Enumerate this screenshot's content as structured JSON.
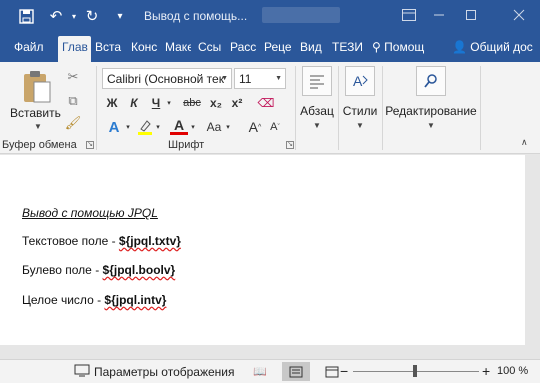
{
  "titlebar": {
    "save_icon": "save-icon",
    "undo_icon": "undo-icon",
    "redo_icon": "redo-icon",
    "customize_icon": "customize-quick-access-icon",
    "doc_title": "Вывод с помощь...",
    "restore_icon": "ribbon-display-options-icon",
    "minimize_icon": "minimize-icon",
    "maximize_icon": "maximize-icon",
    "close_icon": "close-icon"
  },
  "tabs": {
    "items": [
      "Файл",
      "Глав",
      "Вста",
      "Конс",
      "Маке",
      "Ссы",
      "Расс",
      "Реце",
      "Вид",
      "ТЕЗИ"
    ],
    "active_index": 1,
    "tell_me": "Помощ",
    "share": "Общий дос"
  },
  "ribbon": {
    "clipboard": {
      "paste_label": "Вставить",
      "group_label": "Буфер обмена"
    },
    "font": {
      "font_name": "Calibri (Основной тек",
      "font_size": "11",
      "bold": "Ж",
      "italic": "К",
      "underline": "Ч",
      "strike": "abc",
      "subscript": "x₂",
      "superscript": "x²",
      "text_effects": "A",
      "font_color": "A",
      "change_case": "Aa",
      "grow_font": "A",
      "shrink_font": "A",
      "group_label": "Шрифт"
    },
    "paragraph": {
      "label": "Абзац"
    },
    "styles": {
      "label": "Стили"
    },
    "editing": {
      "label": "Редактирование"
    }
  },
  "document": {
    "heading": "Вывод с помощью JPQL",
    "lines": [
      {
        "label": "Текстовое поле - ",
        "field": "${jpql.txtv}"
      },
      {
        "label": "Булево поле - ",
        "field": "${jpql.boolv}"
      },
      {
        "label": "Целое число - ",
        "field": "${jpql.intv}"
      }
    ]
  },
  "statusbar": {
    "display_settings": "Параметры отображения",
    "zoom_minus": "−",
    "zoom_plus": "+",
    "zoom_level": "100 %"
  },
  "colors": {
    "accent": "#2b579a",
    "highlight": "#ffff00",
    "font_color": "#e00000",
    "spelling": "#d22222"
  }
}
